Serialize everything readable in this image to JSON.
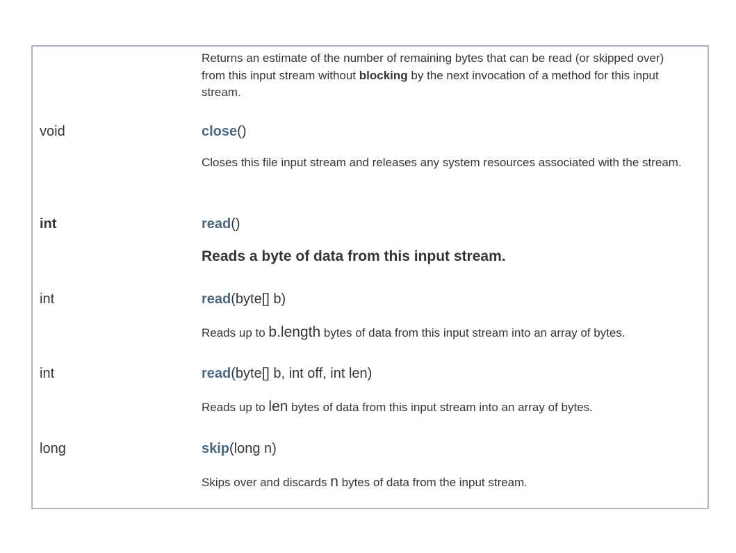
{
  "rows": [
    {
      "type": "",
      "description": {
        "part1": "Returns an estimate of the number of remaining bytes that can be read (or skipped over) from this input stream without ",
        "bold": "blocking",
        "part2": " by the next invocation of a method for this input stream."
      }
    },
    {
      "type": "void",
      "method_name": "close",
      "params": "()",
      "description": "Closes this file input stream and releases any system resources associated with the stream."
    },
    {
      "type": "int",
      "method_name": "read",
      "params": "()",
      "description": "Reads a byte of data from this input stream."
    },
    {
      "type": "int",
      "method_name": "read",
      "params": "(byte[] b)",
      "description": {
        "before": "Reads up to ",
        "code": "b.length",
        "after": " bytes of data from this input stream into an array of bytes."
      }
    },
    {
      "type": "int",
      "method_name": "read",
      "params": "(byte[] b, int off, int len)",
      "description": {
        "before": "Reads up to ",
        "code": "len",
        "after": " bytes of data from this input stream into an array of bytes."
      }
    },
    {
      "type": "long",
      "method_name": "skip",
      "params": "(long n)",
      "description": {
        "before": "Skips over and discards ",
        "code": "n",
        "after": " bytes of data from the input stream."
      }
    }
  ],
  "colors": {
    "link": "#4a6782",
    "border": "#a9b4c4",
    "text": "#353535"
  }
}
